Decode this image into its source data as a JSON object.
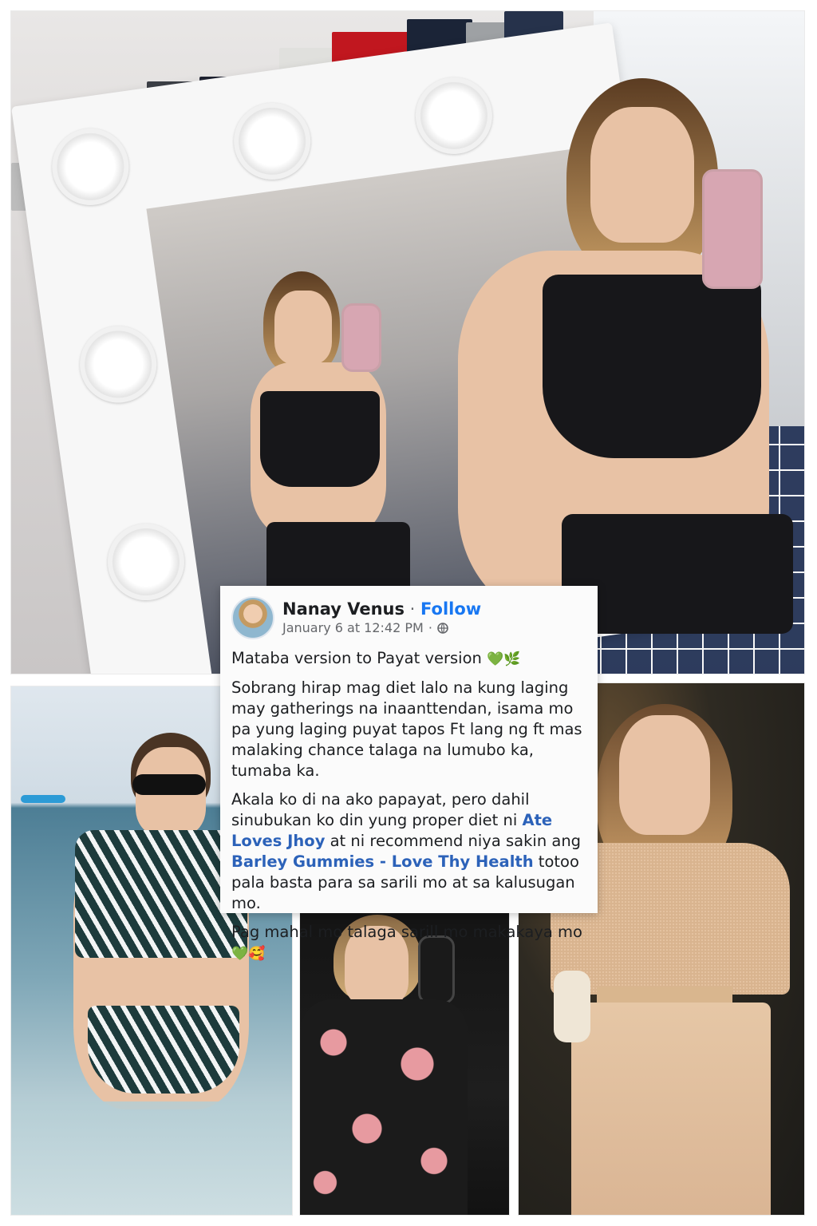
{
  "post": {
    "author": "Nanay Venus",
    "separator": "·",
    "follow_label": "Follow",
    "timestamp": "January 6 at 12:42 PM",
    "timestamp_separator": "·",
    "line_title": "Mataba version to Payat version",
    "title_emoji": "💚🌿",
    "paragraph1": "Sobrang hirap mag diet lalo na kung  laging may gatherings na inaanttendan, isama mo pa yung laging puyat tapos Ft lang ng ft mas malaking chance talaga na lumubo ka, tumaba ka.",
    "p2_part1": "Akala ko di na ako papayat, pero dahil sinubukan ko din yung proper diet ni ",
    "p2_link1": "Ate Loves Jhoy",
    "p2_part2": " at ni recommend niya sakin ang ",
    "p2_link2": "Barley Gummies - Love Thy Health",
    "p2_part3": " totoo pala basta para sa sarili mo at sa kalusugan mo.",
    "closing": "Pag mahal mo talaga sarill mo makakaya mo",
    "closing_emoji": "💚🥰"
  },
  "colors": {
    "link": "#2c62b9",
    "follow": "#1877f2",
    "meta": "#65676b",
    "card_bg": "#fbfbfb"
  },
  "icons": [
    "globe-icon",
    "avatar"
  ]
}
